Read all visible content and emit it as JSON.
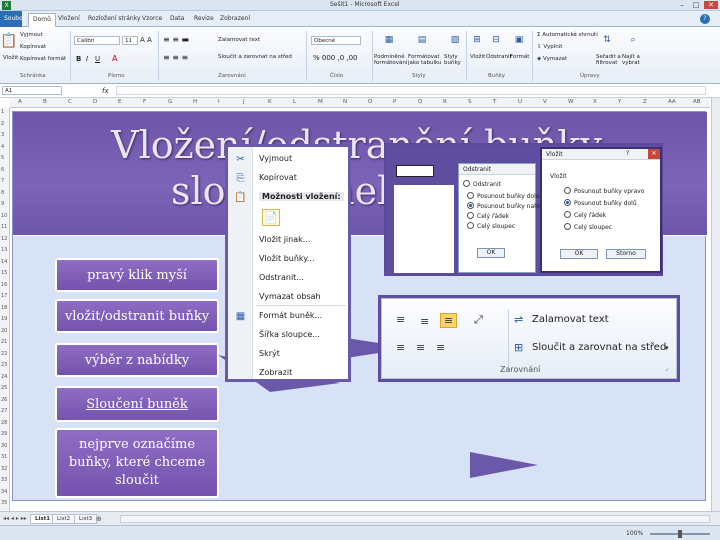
{
  "window": {
    "title": "Sešit1 - Microsoft Excel"
  },
  "tabs": [
    "Soubor",
    "Domů",
    "Vložení",
    "Rozložení stránky",
    "Vzorce",
    "Data",
    "Revize",
    "Zobrazení"
  ],
  "ribbon": {
    "clipboard": {
      "cut": "Vyjmout",
      "copy": "Kopírovat",
      "painter": "Kopírovat formát",
      "group": "Schránka",
      "paste": "Vložit"
    },
    "font": {
      "name": "Calibri",
      "size": "11",
      "group": "Písmo"
    },
    "alignment": {
      "wrap": "Zalamovat text",
      "merge": "Sloučit a zarovnat na střed",
      "group": "Zarovnání"
    },
    "number": {
      "format": "Obecné",
      "group": "Číslo"
    },
    "styles": {
      "cond": "Podmíněné formátování",
      "table": "Formátovat jako tabulku",
      "cell": "Styly buňky",
      "group": "Styly"
    },
    "cells": {
      "insert": "Vložit",
      "delete": "Odstranit",
      "format": "Formát",
      "group": "Buňky"
    },
    "editing": {
      "autosum": "Automatické shrnutí",
      "fill": "Vyplnit",
      "clear": "Vymazat",
      "sort": "Seřadit a filtrovat",
      "find": "Najít a vybrat",
      "group": "Úpravy"
    }
  },
  "formula_bar": {
    "name_box": "A1",
    "fx": "fx",
    "value": ""
  },
  "columns": [
    "A",
    "B",
    "C",
    "D",
    "E",
    "F",
    "G",
    "H",
    "I",
    "J",
    "K",
    "L",
    "M",
    "N",
    "O",
    "P",
    "Q",
    "R",
    "S",
    "T",
    "U",
    "V",
    "W",
    "X",
    "Y",
    "Z",
    "AA",
    "AB"
  ],
  "rows": [
    "1",
    "2",
    "3",
    "4",
    "5",
    "6",
    "7",
    "8",
    "9",
    "10",
    "11",
    "12",
    "13",
    "14",
    "15",
    "16",
    "17",
    "18",
    "19",
    "20",
    "21",
    "22",
    "23",
    "24",
    "25",
    "26",
    "27",
    "28",
    "29",
    "30",
    "31",
    "32",
    "33",
    "34",
    "35"
  ],
  "sheets": [
    "List1",
    "List2",
    "List3"
  ],
  "status": {
    "zoom": "100%"
  },
  "slide": {
    "title_line1": "Vložení/odstranění buňky,",
    "title_line2": "sloupce nebo řádku",
    "labels": [
      "pravý klik myší",
      "vložit/odstranit buňky",
      "výběr z nabídky",
      "Sloučení buněk",
      "nejprve označíme buňky, které chceme sloučit"
    ]
  },
  "context_menu": {
    "items": [
      "Vyjmout",
      "Kopírovat",
      "Možnosti vložení:",
      "Vložit jinak...",
      "Vložit buňky...",
      "Odstranit...",
      "Vymazat obsah",
      "Formát buněk...",
      "Šířka sloupce...",
      "Skrýt",
      "Zobrazit"
    ]
  },
  "dialog_delete": {
    "title": "Odstranit",
    "section": "Odstranit",
    "options": [
      "Posunout buňky doleva",
      "Posunout buňky nahoru",
      "Celý řádek",
      "Celý sloupec"
    ],
    "selected": 1,
    "ok": "OK"
  },
  "dialog_insert": {
    "title": "Vložit",
    "section": "Vložit",
    "options": [
      "Posunout buňky vpravo",
      "Posunout buňky dolů",
      "Celý řádek",
      "Celý sloupec"
    ],
    "selected": 1,
    "ok": "OK",
    "cancel": "Storno"
  },
  "align_panel": {
    "wrap": "Zalamovat text",
    "merge": "Sloučit a zarovnat na střed",
    "group": "Zarovnání"
  }
}
